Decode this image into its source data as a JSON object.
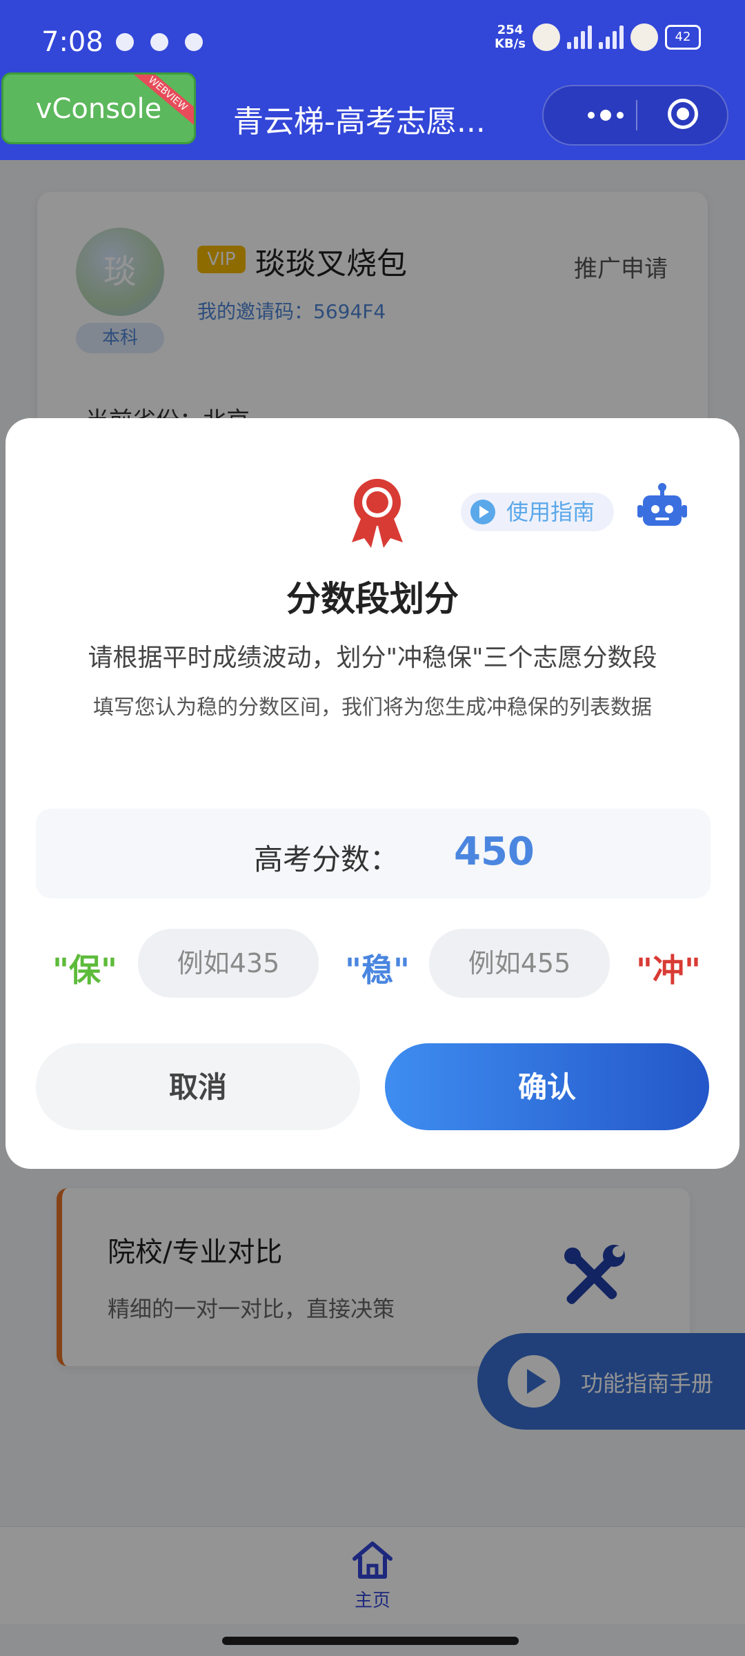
{
  "status_bar": {
    "time": "7:08",
    "net_speed_value": "254",
    "net_speed_unit": "KB/s",
    "battery": "42"
  },
  "header": {
    "vconsole_label": "vConsole",
    "vconsole_ribbon": "WEBVIEW",
    "title": "青云梯-高考志愿..."
  },
  "profile": {
    "avatar_text": "琰",
    "edu_level": "本科",
    "vip_label": "VIP",
    "username": "琰琰叉烧包",
    "invite_code": "我的邀请码：5694F4",
    "promote_label": "推广申请",
    "province": "当前省份：北京"
  },
  "modal": {
    "guide_label": "使用指南",
    "title": "分数段划分",
    "description": "请根据平时成绩波动，划分\"冲稳保\"三个志愿分数段",
    "note": "填写您认为稳的分数区间，我们将为您生成冲稳保的列表数据",
    "score_label": "高考分数：",
    "score_value": "450",
    "tag_bao": "\"保\"",
    "tag_wen": "\"稳\"",
    "tag_chong": "\"冲\"",
    "low_placeholder": "例如435",
    "high_placeholder": "例如455",
    "cancel_label": "取消",
    "confirm_label": "确认"
  },
  "compare_card": {
    "title": "院校/专业对比",
    "subtitle": "精细的一对一对比，直接决策"
  },
  "guide_fab": {
    "label": "功能指南手册"
  },
  "tab_bar": {
    "home_label": "主页"
  },
  "colors": {
    "brand": "#3246d8",
    "accent_blue": "#4a86e0",
    "bao_green": "#5dbb3a",
    "chong_red": "#d83b34",
    "vconsole_green": "#5cb85c"
  }
}
